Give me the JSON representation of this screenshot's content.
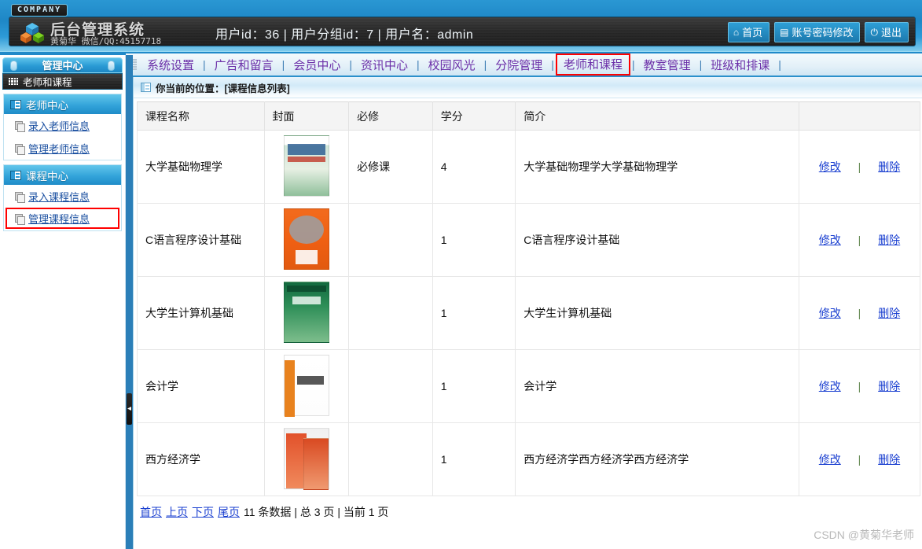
{
  "header": {
    "company_tag": "COMPANY",
    "brand_title": "后台管理系统",
    "brand_sub": "黄菊华 微信/QQ:45157718",
    "user_info": "用户id：36 | 用户分组id：7 | 用户名：admin",
    "buttons": [
      {
        "icon": "home-icon",
        "glyph": "⌂",
        "label": "首页"
      },
      {
        "icon": "document-icon",
        "glyph": "▤",
        "label": "账号密码修改"
      },
      {
        "icon": "power-icon",
        "glyph": "⏻",
        "label": "退出"
      }
    ]
  },
  "nav": {
    "items": [
      {
        "label": "系统设置",
        "active": false
      },
      {
        "label": "广告和留言",
        "active": false
      },
      {
        "label": "会员中心",
        "active": false
      },
      {
        "label": "资讯中心",
        "active": false
      },
      {
        "label": "校园风光",
        "active": false
      },
      {
        "label": "分院管理",
        "active": false
      },
      {
        "label": "老师和课程",
        "active": true
      },
      {
        "label": "教室管理",
        "active": false
      },
      {
        "label": "班级和排课",
        "active": false
      }
    ],
    "separator": "|",
    "highlight_color": "#ff0000"
  },
  "sidebar": {
    "title": "管理中心",
    "current": "老师和课程",
    "groups": [
      {
        "head": "老师中心",
        "links": [
          {
            "label": "录入老师信息",
            "highlighted": false
          },
          {
            "label": "管理老师信息",
            "highlighted": false
          }
        ]
      },
      {
        "head": "课程中心",
        "links": [
          {
            "label": "录入课程信息",
            "highlighted": false
          },
          {
            "label": "管理课程信息",
            "highlighted": true
          }
        ]
      }
    ]
  },
  "content": {
    "breadcrumb": "你当前的位置：[课程信息列表]",
    "table": {
      "headers": [
        "课程名称",
        "封面",
        "必修",
        "学分",
        "简介",
        ""
      ],
      "rows": [
        {
          "name": "大学基础物理学",
          "cover": "book-cover-physics",
          "required": "必修课",
          "credit": "4",
          "intro": "大学基础物理学大学基础物理学",
          "edit": "修改",
          "delete": "删除"
        },
        {
          "name": "C语言程序设计基础",
          "cover": "book-cover-c-language",
          "required": "",
          "credit": "1",
          "intro": "C语言程序设计基础",
          "edit": "修改",
          "delete": "删除"
        },
        {
          "name": "大学生计算机基础",
          "cover": "book-cover-computer",
          "required": "",
          "credit": "1",
          "intro": "大学生计算机基础",
          "edit": "修改",
          "delete": "删除"
        },
        {
          "name": "会计学",
          "cover": "book-cover-accounting",
          "required": "",
          "credit": "1",
          "intro": "会计学",
          "edit": "修改",
          "delete": "删除"
        },
        {
          "name": "西方经济学",
          "cover": "book-cover-economics",
          "required": "",
          "credit": "1",
          "intro": "西方经济学西方经济学西方经济学",
          "edit": "修改",
          "delete": "删除"
        }
      ],
      "action_separator": "|"
    },
    "pager": {
      "first": "首页",
      "prev": "上页",
      "next": "下页",
      "last": "尾页",
      "total_records": "11 条数据",
      "sep1": "|",
      "total_pages": "总 3 页",
      "sep2": "|",
      "current_page": "当前 1 页"
    }
  },
  "watermark": "CSDN @黄菊华老师"
}
